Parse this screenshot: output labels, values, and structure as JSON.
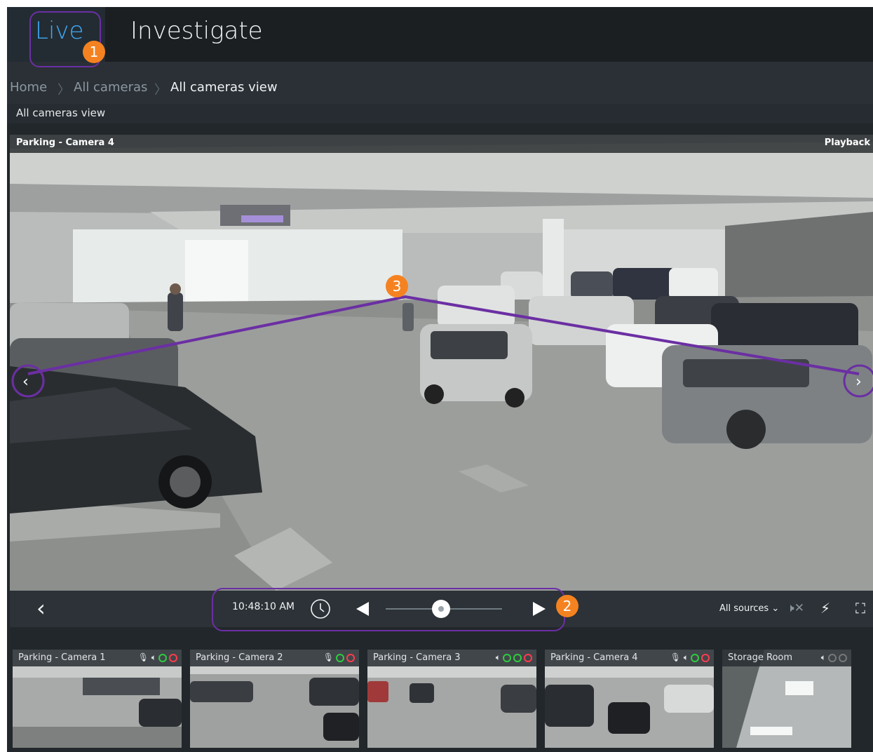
{
  "nav": {
    "live_label": "Live",
    "investigate_label": "Investigate"
  },
  "breadcrumb": {
    "home": "Home",
    "all_cameras": "All cameras",
    "current": "All cameras view"
  },
  "view": {
    "title": "All cameras view"
  },
  "main_video": {
    "camera_title": "Parking - Camera 4",
    "mode_label": "Playback"
  },
  "controls": {
    "time": "10:48:10 AM",
    "sources_label": "All sources ⌄"
  },
  "thumbnails": [
    {
      "title": "Parking - Camera 1"
    },
    {
      "title": "Parking - Camera 2"
    },
    {
      "title": "Parking - Camera 3"
    },
    {
      "title": "Parking - Camera 4"
    },
    {
      "title": "Storage Room"
    }
  ],
  "annotations": {
    "badge_1": "1",
    "badge_2": "2",
    "badge_3": "3"
  },
  "colors": {
    "accent": "#3fa9f5",
    "annotation_outline": "#6b2fa3",
    "annotation_badge": "#f58220"
  }
}
